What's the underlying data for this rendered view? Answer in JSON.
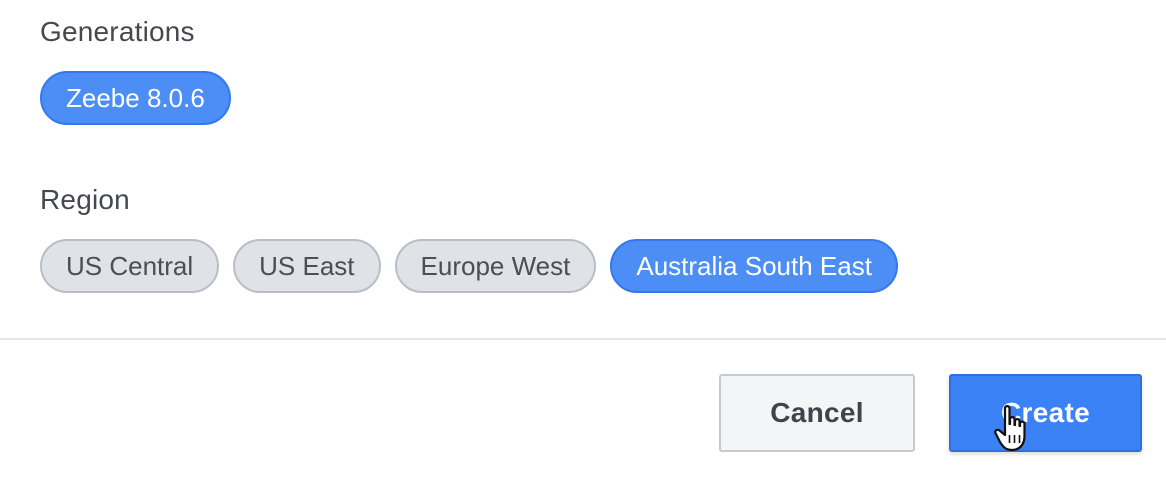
{
  "generations": {
    "label": "Generations",
    "options": [
      {
        "label": "Zeebe 8.0.6",
        "selected": true
      }
    ]
  },
  "region": {
    "label": "Region",
    "options": [
      {
        "label": "US Central",
        "selected": false
      },
      {
        "label": "US East",
        "selected": false
      },
      {
        "label": "Europe West",
        "selected": false
      },
      {
        "label": "Australia South East",
        "selected": true
      }
    ]
  },
  "actions": {
    "cancel_label": "Cancel",
    "create_label": "Create"
  },
  "colors": {
    "selected_chip": "#4c8df6",
    "primary_button": "#3b82f6",
    "unselected_chip": "#dfe2e7"
  },
  "icons": {
    "cursor": "hand-pointer-icon"
  }
}
